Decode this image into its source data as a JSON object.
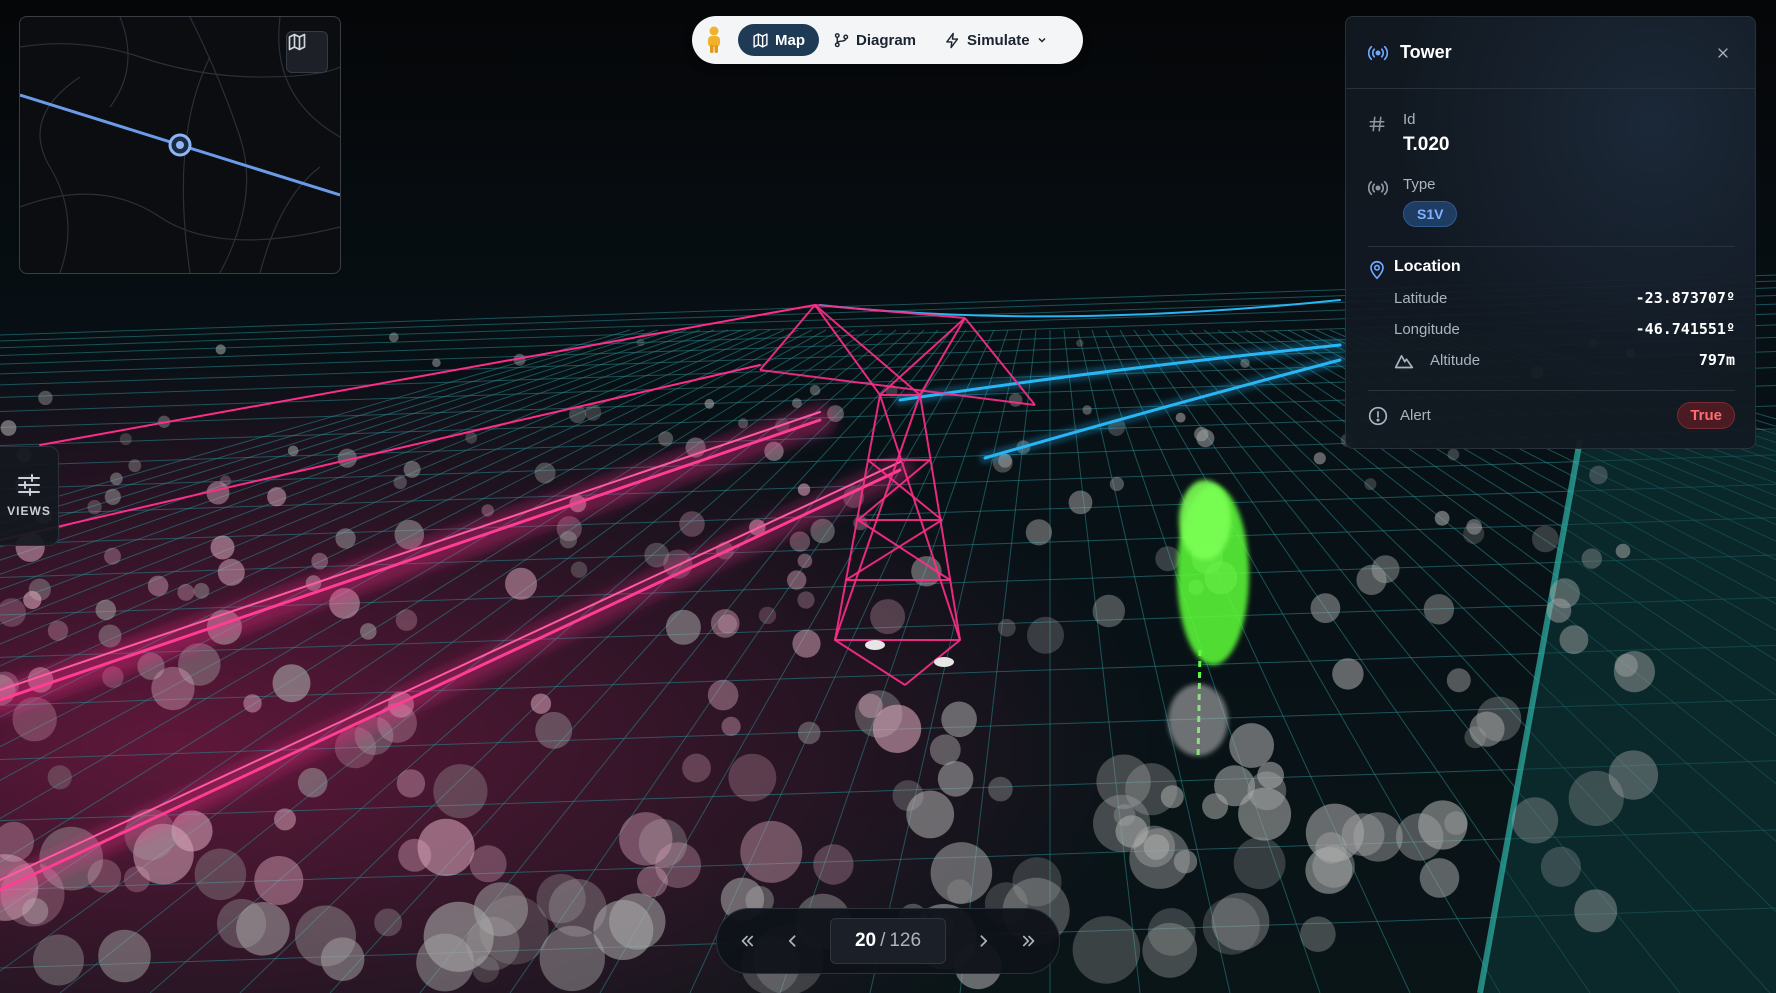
{
  "toolbar": {
    "map_label": "Map",
    "diagram_label": "Diagram",
    "simulate_label": "Simulate"
  },
  "views": {
    "label": "VIEWS"
  },
  "panel": {
    "title": "Tower",
    "id_label": "Id",
    "id_value": "T.020",
    "type_label": "Type",
    "type_value": "S1V",
    "location_label": "Location",
    "latitude_label": "Latitude",
    "latitude_value": "-23.873707º",
    "longitude_label": "Longitude",
    "longitude_value": "-46.741551º",
    "altitude_label": "Altitude",
    "altitude_value": "797m",
    "alert_label": "Alert",
    "alert_value": "True"
  },
  "pagination": {
    "current": "20",
    "separator": "/",
    "total": "126"
  },
  "colors": {
    "accent": "#1e3a55",
    "conductor_pink": "#ff2d8a",
    "conductor_cyan": "#29b6f6",
    "grid": "#2a8a90",
    "tree_alert": "#5dff3a",
    "route_line": "#5b8fe0",
    "alert_red": "#ff6b72"
  }
}
